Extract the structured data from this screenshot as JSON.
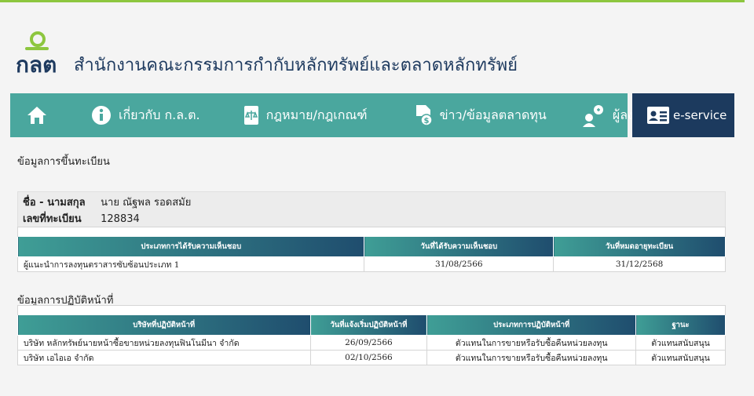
{
  "brand": {
    "logo_text": "กลต",
    "org_name": "สำนักงานคณะกรรมการกำกับหลักทรัพย์และตลาดหลักทรัพย์",
    "accent": "#8dc63f",
    "nav_color": "#4aa79e",
    "eservice_color": "#1c3a5e"
  },
  "nav": {
    "home_icon": "home-icon",
    "items": [
      {
        "label": "เกี่ยวกับ ก.ล.ต.",
        "icon": "info-icon"
      },
      {
        "label": "กฎหมาย/กฎเกณฑ์",
        "icon": "law-book-icon"
      },
      {
        "label": "ข่าว/ข้อมูลตลาดทุน",
        "icon": "news-money-icon"
      },
      {
        "label": "ผู้ลงทุน",
        "icon": "investor-icon"
      }
    ],
    "eservice": {
      "label": "e-service",
      "icon": "id-card-icon"
    }
  },
  "registration": {
    "title": "ข้อมูลการขึ้นทะเบียน",
    "name_label": "ชื่อ - นามสกุล",
    "name_value": "นาย ณัฐพล รอดสมัย",
    "reg_no_label": "เลขที่ทะเบียน",
    "reg_no_value": "128834",
    "table": {
      "headers": [
        "ประเภทการได้รับความเห็นชอบ",
        "วันที่ได้รับความเห็นชอบ",
        "วันที่หมดอายุทะเบียน"
      ],
      "rows": [
        [
          "ผู้แนะนำการลงทุนตราสารซับซ้อนประเภท 1",
          "31/08/2566",
          "31/12/2568"
        ]
      ]
    }
  },
  "duty": {
    "title": "ข้อมูลการปฏิบัติหน้าที่",
    "table": {
      "headers": [
        "บริษัทที่ปฏิบัติหน้าที่",
        "วันที่แจ้งเริ่มปฏิบัติหน้าที่",
        "ประเภทการปฏิบัติหน้าที่",
        "ฐานะ"
      ],
      "rows": [
        [
          "บริษัท หลักทรัพย์นายหน้าซื้อขายหน่วยลงทุนฟินโนมีนา จำกัด",
          "26/09/2566",
          "ตัวแทนในการขายหรือรับซื้อคืนหน่วยลงทุน",
          "ตัวแทนสนับสนุน"
        ],
        [
          "บริษัท เอไอเอ จำกัด",
          "02/10/2566",
          "ตัวแทนในการขายหรือรับซื้อคืนหน่วยลงทุน",
          "ตัวแทนสนับสนุน"
        ]
      ]
    }
  }
}
